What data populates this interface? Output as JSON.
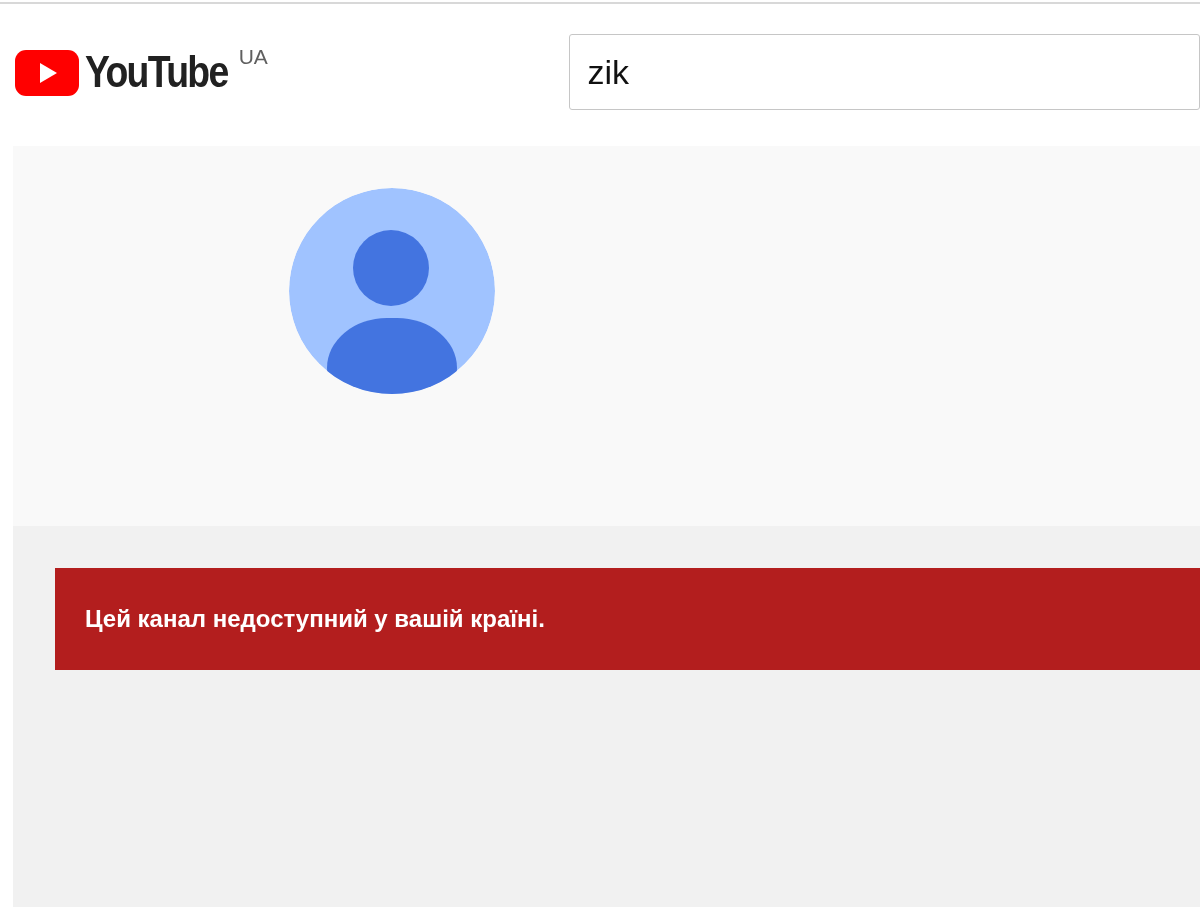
{
  "header": {
    "logo_text": "YouTube",
    "country_code": "UA",
    "search": {
      "value": "zik"
    }
  },
  "channel": {
    "avatar": {
      "kind": "default"
    }
  },
  "alert": {
    "message": "Цей канал недоступний у вашій країні."
  }
}
